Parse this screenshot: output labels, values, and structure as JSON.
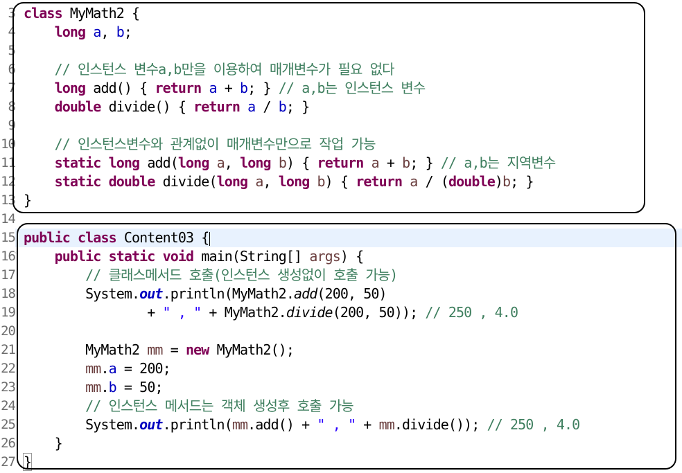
{
  "editor": {
    "lines": [
      {
        "n": "3",
        "tokens": [
          {
            "c": "kw",
            "t": "class"
          },
          {
            "t": " MyMath2 {"
          }
        ]
      },
      {
        "n": "4",
        "tokens": [
          {
            "t": "    "
          },
          {
            "c": "kw",
            "t": "long"
          },
          {
            "t": " "
          },
          {
            "c": "fld",
            "t": "a"
          },
          {
            "t": ", "
          },
          {
            "c": "fld",
            "t": "b"
          },
          {
            "t": ";"
          }
        ]
      },
      {
        "n": "5",
        "tokens": []
      },
      {
        "n": "6",
        "tokens": [
          {
            "t": "    "
          },
          {
            "c": "cmt",
            "t": "// 인스턴스 변수a,b만을 이용하여 매개변수가 필요 없다"
          }
        ]
      },
      {
        "n": "7",
        "tokens": [
          {
            "t": "    "
          },
          {
            "c": "kw",
            "t": "long"
          },
          {
            "t": " add() { "
          },
          {
            "c": "kw",
            "t": "return"
          },
          {
            "t": " "
          },
          {
            "c": "fld",
            "t": "a"
          },
          {
            "t": " + "
          },
          {
            "c": "fld",
            "t": "b"
          },
          {
            "t": "; } "
          },
          {
            "c": "cmt",
            "t": "// a,b는 인스턴스 변수"
          }
        ]
      },
      {
        "n": "8",
        "tokens": [
          {
            "t": "    "
          },
          {
            "c": "kw",
            "t": "double"
          },
          {
            "t": " divide() { "
          },
          {
            "c": "kw",
            "t": "return"
          },
          {
            "t": " "
          },
          {
            "c": "fld",
            "t": "a"
          },
          {
            "t": " / "
          },
          {
            "c": "fld",
            "t": "b"
          },
          {
            "t": "; }"
          }
        ]
      },
      {
        "n": "9",
        "tokens": []
      },
      {
        "n": "10",
        "tokens": [
          {
            "t": "    "
          },
          {
            "c": "cmt",
            "t": "// 인스턴스변수와 관계없이 매개변수만으로 작업 가능"
          }
        ]
      },
      {
        "n": "11",
        "tokens": [
          {
            "t": "    "
          },
          {
            "c": "kw",
            "t": "static"
          },
          {
            "t": " "
          },
          {
            "c": "kw",
            "t": "long"
          },
          {
            "t": " add("
          },
          {
            "c": "kw",
            "t": "long"
          },
          {
            "t": " "
          },
          {
            "c": "var",
            "t": "a"
          },
          {
            "t": ", "
          },
          {
            "c": "kw",
            "t": "long"
          },
          {
            "t": " "
          },
          {
            "c": "var",
            "t": "b"
          },
          {
            "t": ") { "
          },
          {
            "c": "kw",
            "t": "return"
          },
          {
            "t": " "
          },
          {
            "c": "var",
            "t": "a"
          },
          {
            "t": " + "
          },
          {
            "c": "var",
            "t": "b"
          },
          {
            "t": "; } "
          },
          {
            "c": "cmt",
            "t": "// a,b는 지역변수"
          }
        ]
      },
      {
        "n": "12",
        "tokens": [
          {
            "t": "    "
          },
          {
            "c": "kw",
            "t": "static"
          },
          {
            "t": " "
          },
          {
            "c": "kw",
            "t": "double"
          },
          {
            "t": " divide("
          },
          {
            "c": "kw",
            "t": "long"
          },
          {
            "t": " "
          },
          {
            "c": "var",
            "t": "a"
          },
          {
            "t": ", "
          },
          {
            "c": "kw",
            "t": "long"
          },
          {
            "t": " "
          },
          {
            "c": "var",
            "t": "b"
          },
          {
            "t": ") { "
          },
          {
            "c": "kw",
            "t": "return"
          },
          {
            "t": " "
          },
          {
            "c": "var",
            "t": "a"
          },
          {
            "t": " / ("
          },
          {
            "c": "kw",
            "t": "double"
          },
          {
            "t": ")"
          },
          {
            "c": "var",
            "t": "b"
          },
          {
            "t": "; }"
          }
        ]
      },
      {
        "n": "13",
        "tokens": [
          {
            "t": "}"
          }
        ]
      },
      {
        "n": "14",
        "tokens": []
      },
      {
        "n": "15",
        "tokens": [
          {
            "c": "kw",
            "t": "public"
          },
          {
            "t": " "
          },
          {
            "c": "kw",
            "t": "class"
          },
          {
            "t": " Content03 {"
          },
          {
            "c": "caret",
            "t": ""
          }
        ]
      },
      {
        "n": "16",
        "tokens": [
          {
            "t": "    "
          },
          {
            "c": "kw",
            "t": "public"
          },
          {
            "t": " "
          },
          {
            "c": "kw",
            "t": "static"
          },
          {
            "t": " "
          },
          {
            "c": "kw",
            "t": "void"
          },
          {
            "t": " main(String[] "
          },
          {
            "c": "var",
            "t": "args"
          },
          {
            "t": ") {"
          }
        ]
      },
      {
        "n": "17",
        "tokens": [
          {
            "t": "        "
          },
          {
            "c": "cmt",
            "t": "// 클래스메서드 호출(인스턴스 생성없이 호출 가능)"
          }
        ]
      },
      {
        "n": "18",
        "tokens": [
          {
            "t": "        System."
          },
          {
            "c": "sfld",
            "t": "out"
          },
          {
            "t": ".println(MyMath2."
          },
          {
            "c": "smth",
            "t": "add"
          },
          {
            "t": "(200, 50)"
          }
        ]
      },
      {
        "n": "19",
        "tokens": [
          {
            "t": "                + "
          },
          {
            "c": "str",
            "t": "\" , \""
          },
          {
            "t": " + MyMath2."
          },
          {
            "c": "smth",
            "t": "divide"
          },
          {
            "t": "(200, 50)); "
          },
          {
            "c": "cmt",
            "t": "// 250 , 4.0"
          }
        ]
      },
      {
        "n": "20",
        "tokens": []
      },
      {
        "n": "21",
        "tokens": [
          {
            "t": "        MyMath2 "
          },
          {
            "c": "var",
            "t": "mm"
          },
          {
            "t": " = "
          },
          {
            "c": "kw",
            "t": "new"
          },
          {
            "t": " MyMath2();"
          }
        ]
      },
      {
        "n": "22",
        "tokens": [
          {
            "t": "        "
          },
          {
            "c": "var",
            "t": "mm"
          },
          {
            "t": "."
          },
          {
            "c": "fld",
            "t": "a"
          },
          {
            "t": " = 200;"
          }
        ]
      },
      {
        "n": "23",
        "tokens": [
          {
            "t": "        "
          },
          {
            "c": "var",
            "t": "mm"
          },
          {
            "t": "."
          },
          {
            "c": "fld",
            "t": "b"
          },
          {
            "t": " = 50;"
          }
        ]
      },
      {
        "n": "24",
        "tokens": [
          {
            "t": "        "
          },
          {
            "c": "cmt",
            "t": "// 인스턴스 메서드는 객체 생성후 호출 가능"
          }
        ]
      },
      {
        "n": "25",
        "tokens": [
          {
            "t": "        System."
          },
          {
            "c": "sfld",
            "t": "out"
          },
          {
            "t": ".println("
          },
          {
            "c": "var",
            "t": "mm"
          },
          {
            "t": ".add() + "
          },
          {
            "c": "str",
            "t": "\" , \""
          },
          {
            "t": " + "
          },
          {
            "c": "var",
            "t": "mm"
          },
          {
            "t": ".divide()); "
          },
          {
            "c": "cmt",
            "t": "// 250 , 4.0"
          }
        ]
      },
      {
        "n": "26",
        "tokens": [
          {
            "t": "    }"
          }
        ]
      },
      {
        "n": "27",
        "tokens": [
          {
            "c": "brk",
            "t": "}"
          }
        ]
      }
    ],
    "highlight_line": "15",
    "syntax_colors": {
      "keyword": "#7f0055",
      "field": "#0000c0",
      "comment": "#3f7f5f",
      "string": "#2a00ff",
      "local_variable": "#6a3e3e",
      "current_line": "#e8f2fe"
    }
  }
}
